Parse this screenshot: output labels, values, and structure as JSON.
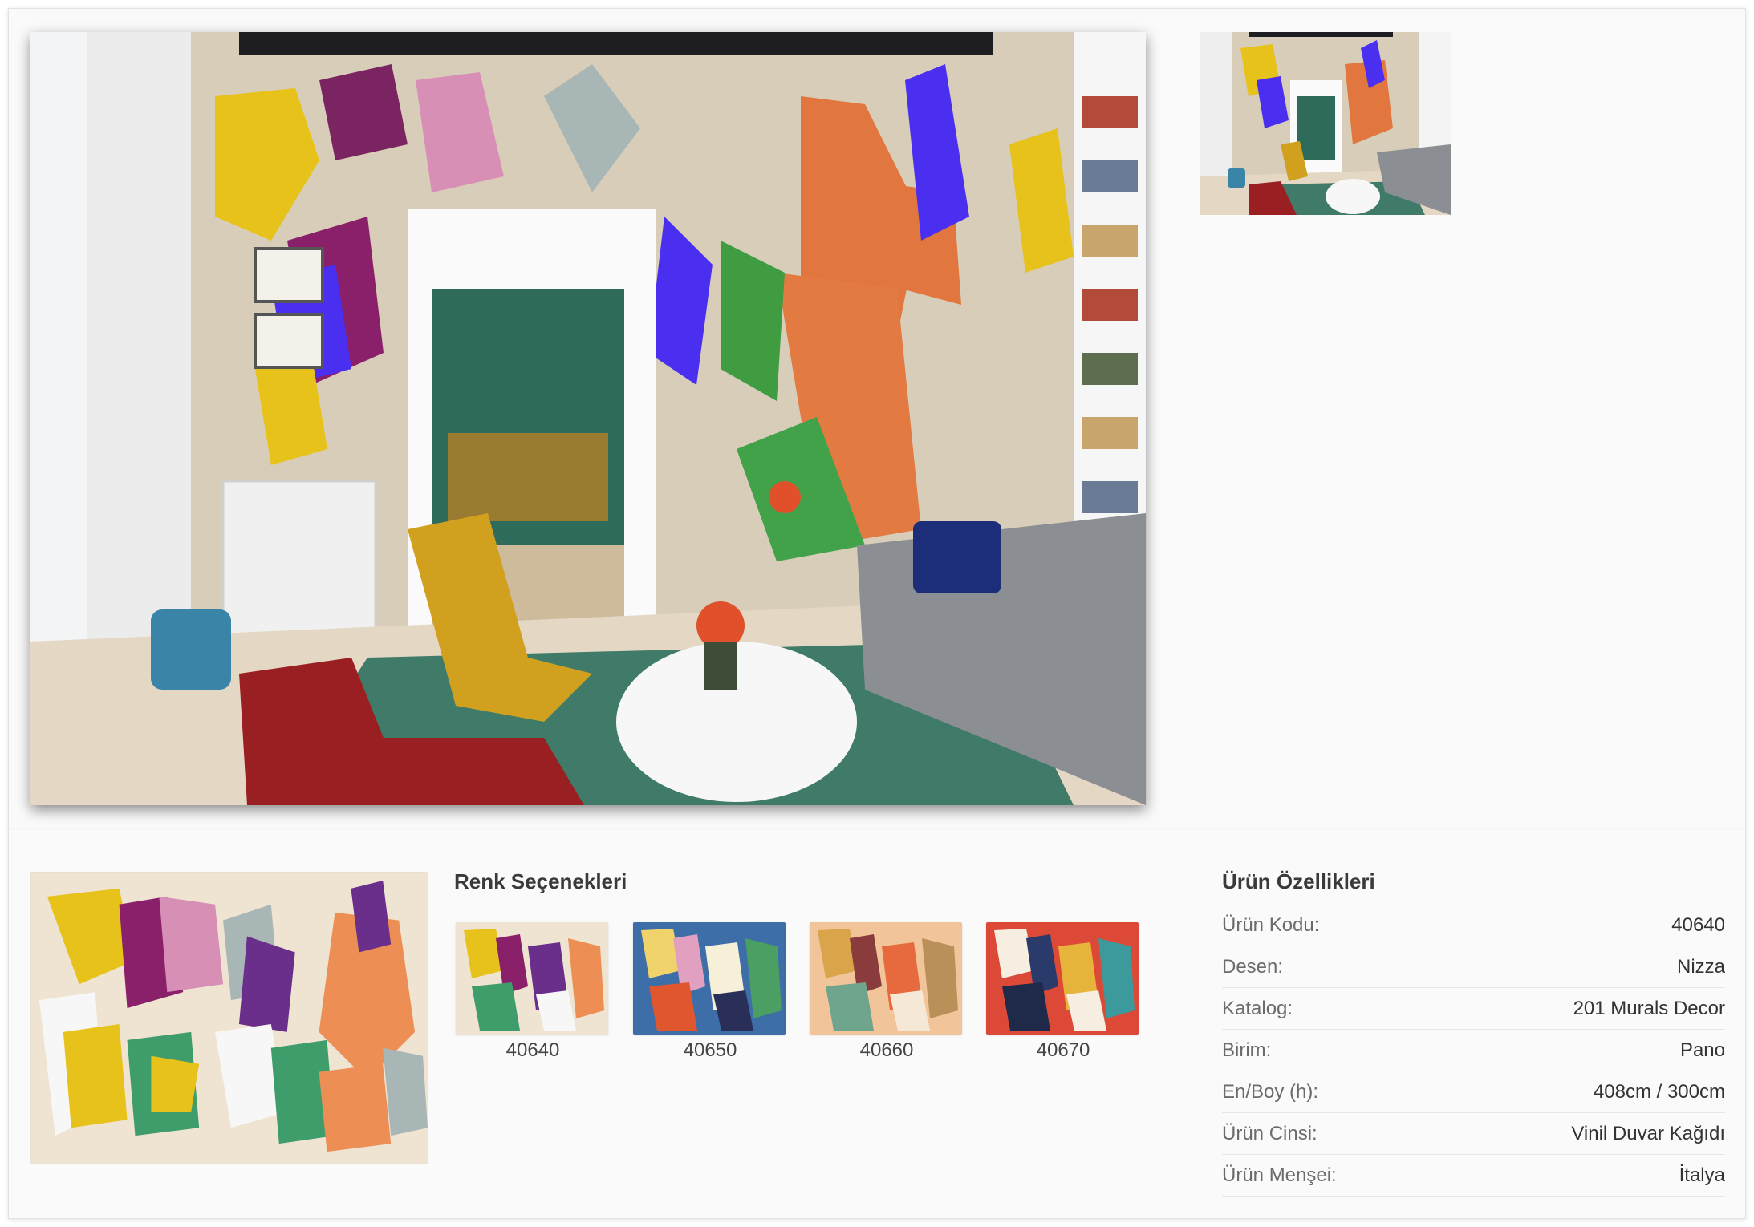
{
  "gallery": {
    "main_image": "room-interior-photo",
    "thumbnails": [
      "room-interior-thumbnail"
    ]
  },
  "pattern_preview": "nizza-pattern-artwork",
  "color_options": {
    "title": "Renk Seçenekleri",
    "items": [
      {
        "code": "40640",
        "bg": "#efe3d2"
      },
      {
        "code": "40650",
        "bg": "#3d6ea8"
      },
      {
        "code": "40660",
        "bg": "#f2c49a"
      },
      {
        "code": "40670",
        "bg": "#dc4a37"
      }
    ]
  },
  "specs": {
    "title": "Ürün Özellikleri",
    "rows": [
      {
        "label": "Ürün Kodu:",
        "value": "40640"
      },
      {
        "label": "Desen:",
        "value": "Nizza"
      },
      {
        "label": "Katalog:",
        "value": "201 Murals Decor"
      },
      {
        "label": "Birim:",
        "value": "Pano"
      },
      {
        "label": "En/Boy (h):",
        "value": "408cm / 300cm"
      },
      {
        "label": "Ürün Cinsi:",
        "value": "Vinil Duvar Kağıdı"
      },
      {
        "label": "Ürün Menşei:",
        "value": "İtalya"
      }
    ]
  },
  "colors": {
    "frame_bg": "#fafafa",
    "title_text": "#3a3a3a",
    "label_text": "#6b6b6b"
  }
}
